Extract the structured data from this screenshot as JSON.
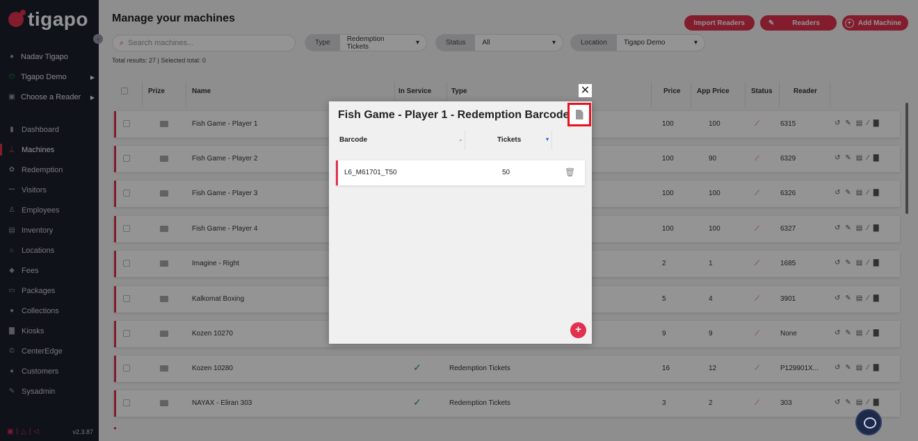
{
  "brand": {
    "name": "tigapo"
  },
  "sidebar": {
    "user": "Nadav Tigapo",
    "location": "Tigapo Demo",
    "reader": "Choose a Reader",
    "items": [
      {
        "label": "Dashboard",
        "icon": "chart-icon"
      },
      {
        "label": "Machines",
        "icon": "joystick-icon"
      },
      {
        "label": "Redemption",
        "icon": "gift-icon"
      },
      {
        "label": "Visitors",
        "icon": "users-icon"
      },
      {
        "label": "Employees",
        "icon": "badge-icon"
      },
      {
        "label": "Inventory",
        "icon": "box-icon"
      },
      {
        "label": "Locations",
        "icon": "map-icon"
      },
      {
        "label": "Fees",
        "icon": "tag-icon"
      },
      {
        "label": "Packages",
        "icon": "ticket-icon"
      },
      {
        "label": "Collections",
        "icon": "coin-icon"
      },
      {
        "label": "Kiosks",
        "icon": "kiosk-icon"
      },
      {
        "label": "CenterEdge",
        "icon": "c-icon"
      },
      {
        "label": "Customers",
        "icon": "user-icon"
      },
      {
        "label": "Sysadmin",
        "icon": "edit-icon"
      }
    ],
    "version": "v2.3.87"
  },
  "header": {
    "title": "Manage your machines",
    "buttons": {
      "import": "Import Readers",
      "readers": "Readers",
      "add": "Add Machine"
    }
  },
  "filters": {
    "search_placeholder": "Search machines...",
    "type_label": "Type",
    "type_value": "Redemption Tickets",
    "status_label": "Status",
    "status_value": "All",
    "location_label": "Location",
    "location_value": "Tigapo Demo"
  },
  "results_text": "Total results: 27 | Selected total: 0",
  "table": {
    "columns": {
      "prize": "Prize",
      "name": "Name",
      "in_service": "In Service",
      "type": "Type",
      "price": "Price",
      "app_price": "App Price",
      "status": "Status",
      "reader": "Reader"
    },
    "rows": [
      {
        "name": "Fish Game - Player 1",
        "type": "",
        "price": "100",
        "app_price": "100",
        "reader": "6315",
        "in_service": false
      },
      {
        "name": "Fish Game - Player 2",
        "type": "",
        "price": "100",
        "app_price": "90",
        "reader": "6329",
        "in_service": false
      },
      {
        "name": "Fish Game - Player 3",
        "type": "",
        "price": "100",
        "app_price": "100",
        "reader": "6326",
        "in_service": false
      },
      {
        "name": "Fish Game - Player 4",
        "type": "",
        "price": "100",
        "app_price": "100",
        "reader": "6327",
        "in_service": false
      },
      {
        "name": "Imagine - Right",
        "type": "",
        "price": "2",
        "app_price": "1",
        "reader": "1685",
        "in_service": false
      },
      {
        "name": "Kalkomat Boxing",
        "type": "",
        "price": "5",
        "app_price": "4",
        "reader": "3901",
        "in_service": false
      },
      {
        "name": "Kozen 10270",
        "type": "",
        "price": "9",
        "app_price": "9",
        "reader": "None",
        "in_service": false
      },
      {
        "name": "Kozen 10280",
        "type": "Redemption Tickets",
        "price": "16",
        "app_price": "12",
        "reader": "P129901X...",
        "in_service": true
      },
      {
        "name": "NAYAX - Eliran 303",
        "type": "Redemption Tickets",
        "price": "3",
        "app_price": "2",
        "reader": "303",
        "in_service": true
      }
    ]
  },
  "modal": {
    "title": "Fish Game - Player 1 - Redemption Barcodes",
    "columns": {
      "barcode": "Barcode",
      "tickets": "Tickets"
    },
    "rows": [
      {
        "barcode": "L6_M61701_T50",
        "tickets": "50"
      }
    ]
  },
  "colors": {
    "accent": "#e2314f",
    "sidebar": "#1c1f2e",
    "highlight": "#e8121f"
  }
}
